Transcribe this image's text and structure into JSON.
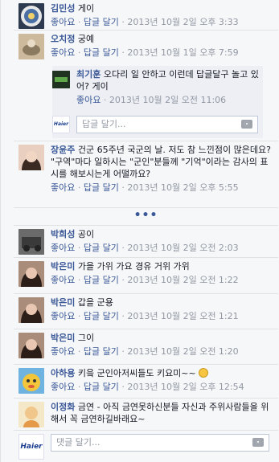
{
  "comments": [
    {
      "name": "김민성",
      "text": "게이",
      "like": "좋아요",
      "reply": "답글 달기",
      "time": "2013년 10월 2일 오후 3:33"
    },
    {
      "name": "오치정",
      "text": "궁예",
      "like": "좋아요",
      "reply": "답글 달기",
      "time": "2013년 10월 1일 오후 7:59"
    },
    {
      "name": "장윤주",
      "text": "건군 65주년 국군의 날. 저도 참 느낀점이 많은데요? \"구역\"마다 일하시는 \"군인\"분들께 \"기억\"이라는 감사의 표시를 해보시는게 어떨까요?",
      "like": "좋아요",
      "reply": "답글 달기",
      "time": "2013년 10월 2일 오후 5:55"
    },
    {
      "name": "박희성",
      "text": "공이",
      "like": "좋아요",
      "reply": "답글 달기",
      "time": "2013년 10월 2일 오전 2:03"
    },
    {
      "name": "박은미",
      "text": "가을 가위 가요 경유 거위 가위",
      "like": "좋아요",
      "reply": "답글 달기",
      "time": "2013년 10월 2일 오전 1:22"
    },
    {
      "name": "박은미",
      "text": "갑을 군용",
      "like": "좋아요",
      "reply": "답글 달기",
      "time": "2013년 10월 2일 오전 1:21"
    },
    {
      "name": "박은미",
      "text": "그이",
      "like": "좋아요",
      "reply": "답글 달기",
      "time": "2013년 10월 2일 오전 1:20"
    },
    {
      "name": "아하용",
      "text": "키읔 군인아저씨들도 키요미~~",
      "like": "좋아요",
      "reply": "답글 달기",
      "time": "2013년 10월 2일 오후 12:54"
    },
    {
      "name": "이정화",
      "text": "금연 - 아직 금연못하신분들 자신과 주위사람들을 위해서 꼭 금연하길바래요~"
    }
  ],
  "nested_reply": {
    "name": "최기훈",
    "text": "오다리 일 안하고 이런데 답글달구 놀고 있어? 게이",
    "like": "좋아요",
    "time": "2013년 10월 2일 오전 11:06"
  },
  "reply_input_placeholder": "답글 달기...",
  "main_input_placeholder": "댓글 달기...",
  "more_link": "•••",
  "sep": "·",
  "page_name": "Haier",
  "colors": {
    "link": "#3b5998",
    "meta": "#9197a3",
    "background": "#f6f7f8",
    "border": "#e1e2e3"
  }
}
